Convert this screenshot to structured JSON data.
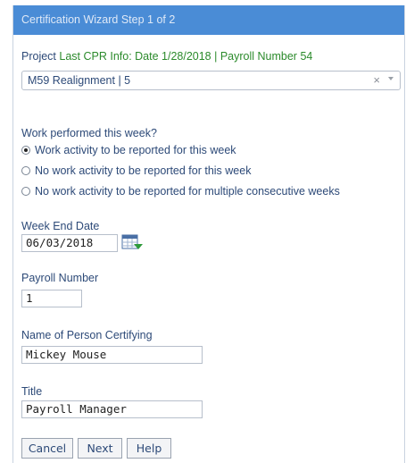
{
  "dialog": {
    "title": "Certification Wizard Step 1 of 2"
  },
  "project": {
    "label": "Project",
    "cpr_info": "Last CPR Info: Date 1/28/2018 | Payroll Number 54",
    "selected": "M59 Realignment | 5",
    "clear_glyph": "×"
  },
  "work": {
    "question": "Work performed this week?",
    "options": [
      {
        "label": "Work activity to be reported for this week",
        "checked": true
      },
      {
        "label": "No work activity to be reported for this week",
        "checked": false
      },
      {
        "label": "No work activity to be reported for multiple consecutive weeks",
        "checked": false
      }
    ]
  },
  "week_end": {
    "label": "Week End Date",
    "value": "06/03/2018"
  },
  "payroll": {
    "label": "Payroll Number",
    "value": "1"
  },
  "certifier": {
    "label": "Name of Person Certifying",
    "value": "Mickey Mouse"
  },
  "title_field": {
    "label": "Title",
    "value": "Payroll Manager"
  },
  "buttons": {
    "cancel": "Cancel",
    "next": "Next",
    "help": "Help"
  },
  "colors": {
    "title_bar": "#4a8cd6",
    "label_text": "#2d4a78",
    "cpr_info": "#2b8a2b"
  },
  "icons": {
    "calendar": "calendar-icon",
    "dropdown": "chevron-down-icon"
  }
}
